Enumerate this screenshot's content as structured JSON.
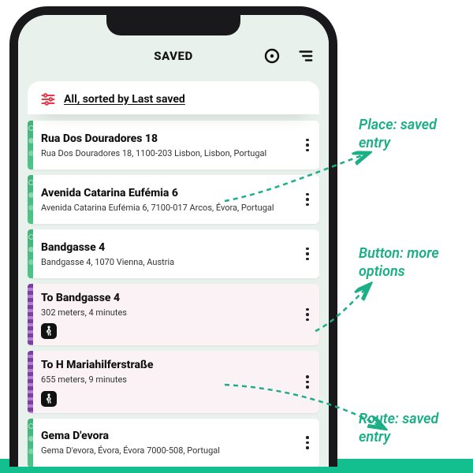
{
  "header": {
    "title": "SAVED"
  },
  "filter": {
    "label": "All, sorted by Last saved"
  },
  "items": [
    {
      "kind": "place",
      "title": "Rua Dos Douradores 18",
      "subtitle": "Rua Dos Douradores 18, 1100-203 Lisbon, Lisbon, Portugal"
    },
    {
      "kind": "place",
      "title": "Avenida Catarina Eufémia 6",
      "subtitle": "Avenida Catarina Eufémia 6, 7100-017 Arcos, Évora, Portugal"
    },
    {
      "kind": "place",
      "title": "Bandgasse 4",
      "subtitle": "Bandgasse 4, 1070 Vienna, Austria"
    },
    {
      "kind": "route",
      "title": "To Bandgasse 4",
      "subtitle": "302 meters, 4 minutes"
    },
    {
      "kind": "route",
      "title": "To H Mariahilferstraße",
      "subtitle": "655 meters, 9 minutes"
    },
    {
      "kind": "place",
      "title": "Gema D'evora",
      "subtitle": "Gema D'evora, Évora, Évora 7000-508, Portugal"
    }
  ],
  "annotations": {
    "place": "Place: saved entry",
    "button": "Button: more options",
    "route": "Route: saved entry"
  },
  "colors": {
    "accent": "#1aaf86",
    "routeStripe": "#7a3fa0",
    "placeStripe": "#41b37a",
    "filterIcon": "#e63a4a"
  }
}
